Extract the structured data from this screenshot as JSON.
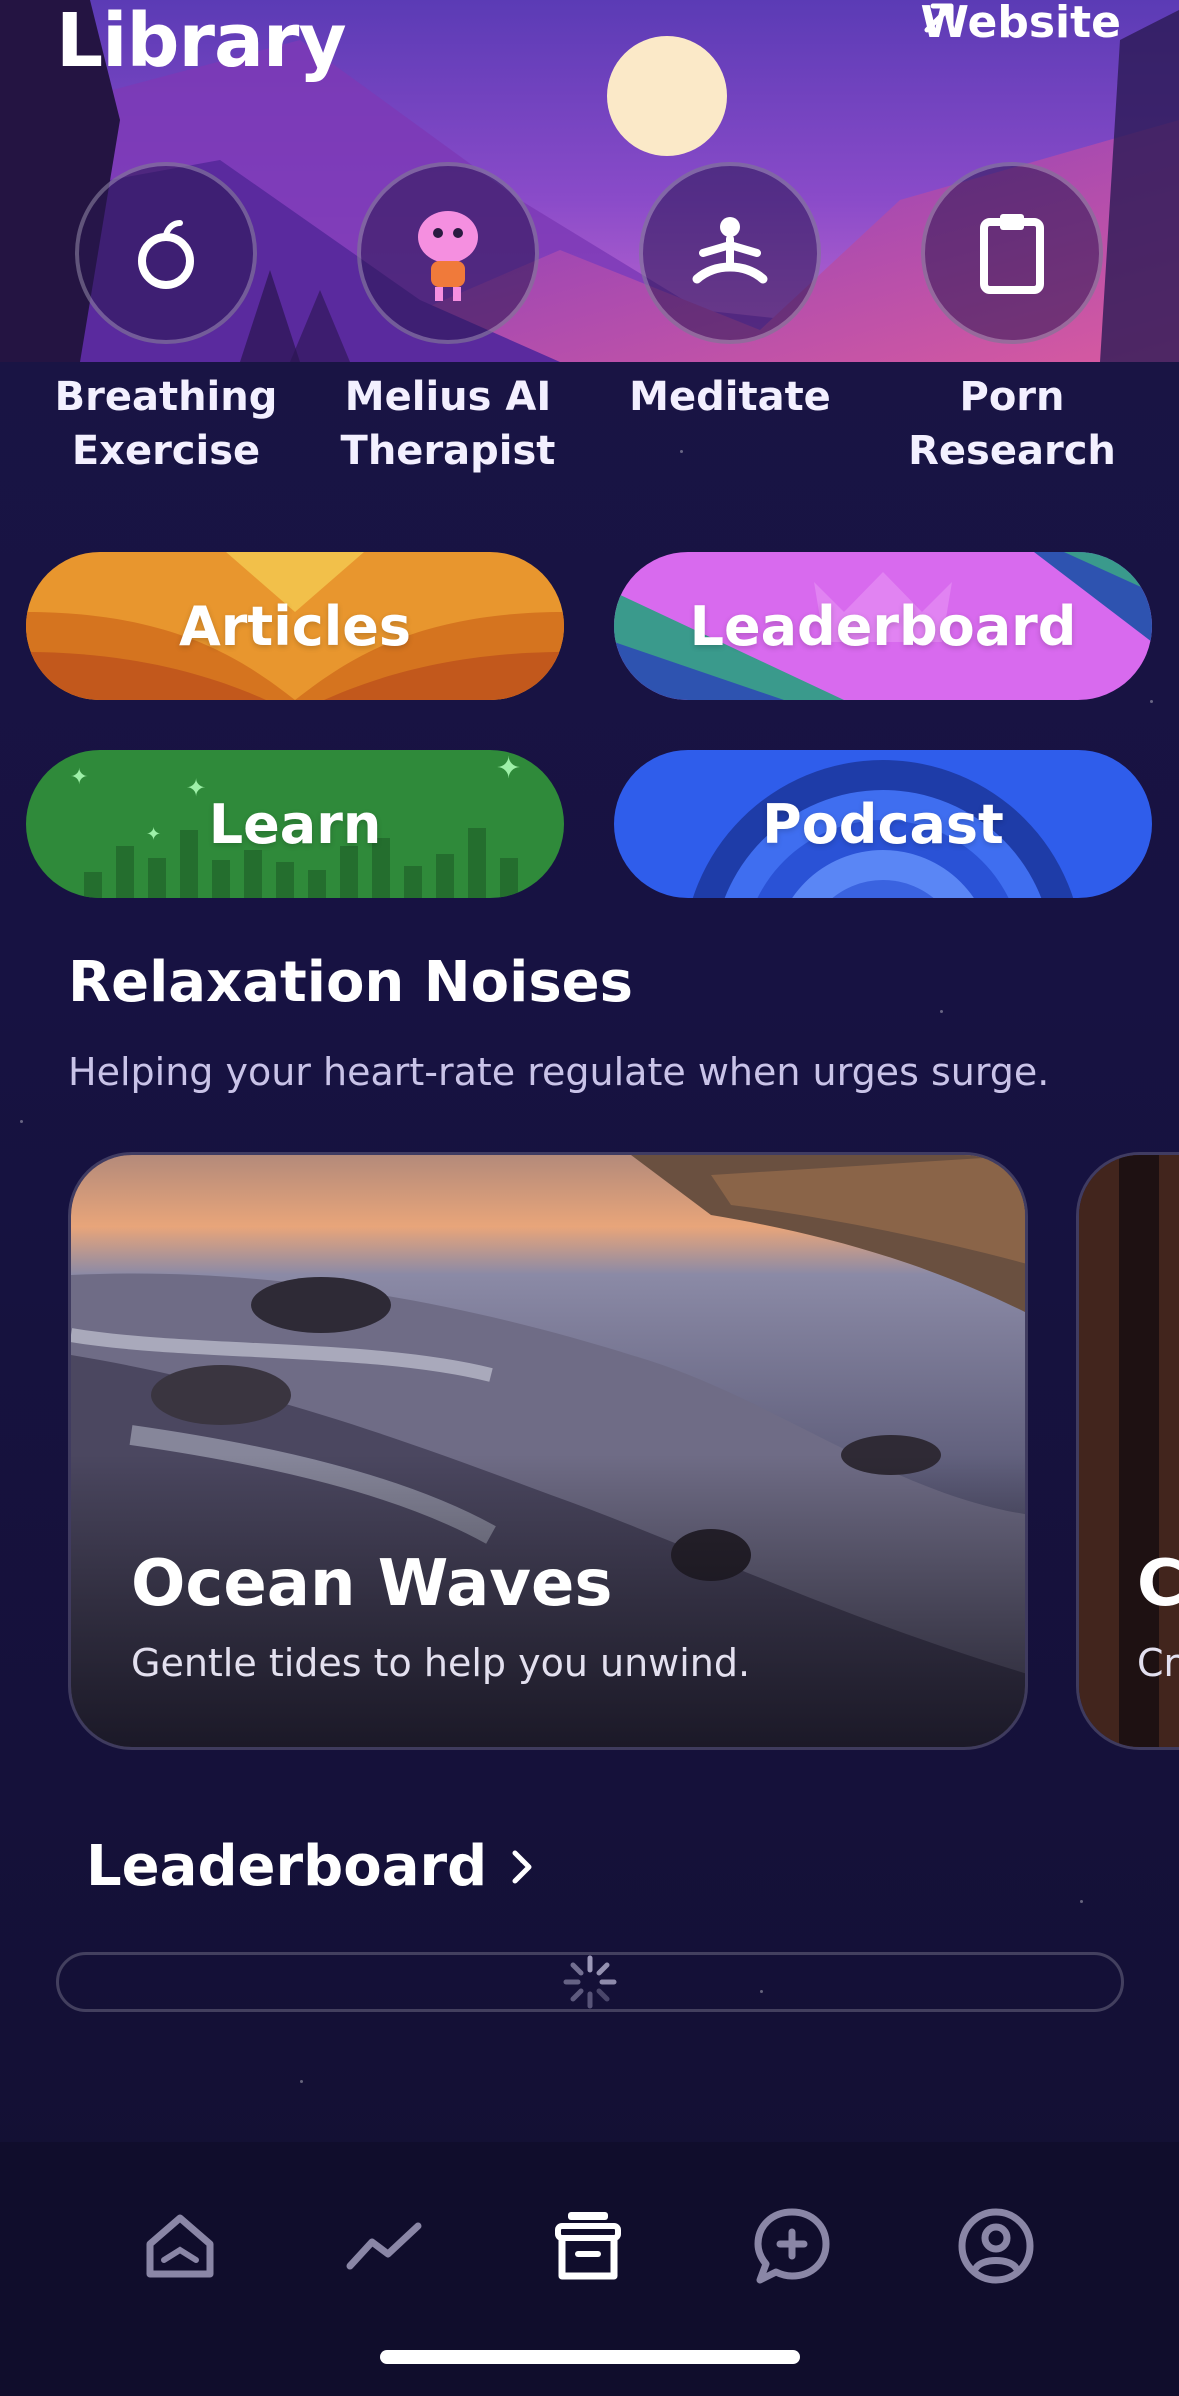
{
  "header": {
    "title": "Library",
    "website_label": "Website"
  },
  "shortcuts": [
    {
      "label": "Breathing\nExercise",
      "icon": "apple-icon"
    },
    {
      "label": "Melius AI\nTherapist",
      "icon": "ai-mascot-icon"
    },
    {
      "label": "Meditate",
      "icon": "meditate-icon"
    },
    {
      "label": "Porn\nResearch",
      "icon": "clipboard-icon"
    }
  ],
  "features": {
    "articles": "Articles",
    "leaderboard": "Leaderboard",
    "learn": "Learn",
    "podcast": "Podcast"
  },
  "relaxation": {
    "title": "Relaxation Noises",
    "subtitle": "Helping your heart-rate regulate when urges surge.",
    "cards": [
      {
        "title": "Ocean Waves",
        "subtitle": "Gentle tides to help you unwind."
      },
      {
        "title": "C",
        "subtitle": "Cr"
      }
    ]
  },
  "leaderboard": {
    "title": "Leaderboard"
  },
  "tabbar": {
    "tabs": [
      "home-icon",
      "trend-icon",
      "library-icon",
      "chat-plus-icon",
      "profile-icon"
    ],
    "active": "library-icon"
  },
  "colors": {
    "articles": "#E8962E",
    "leaderboard": "#D86AEE",
    "learn": "#2F8A3A",
    "podcast": "#2F5DEB"
  }
}
